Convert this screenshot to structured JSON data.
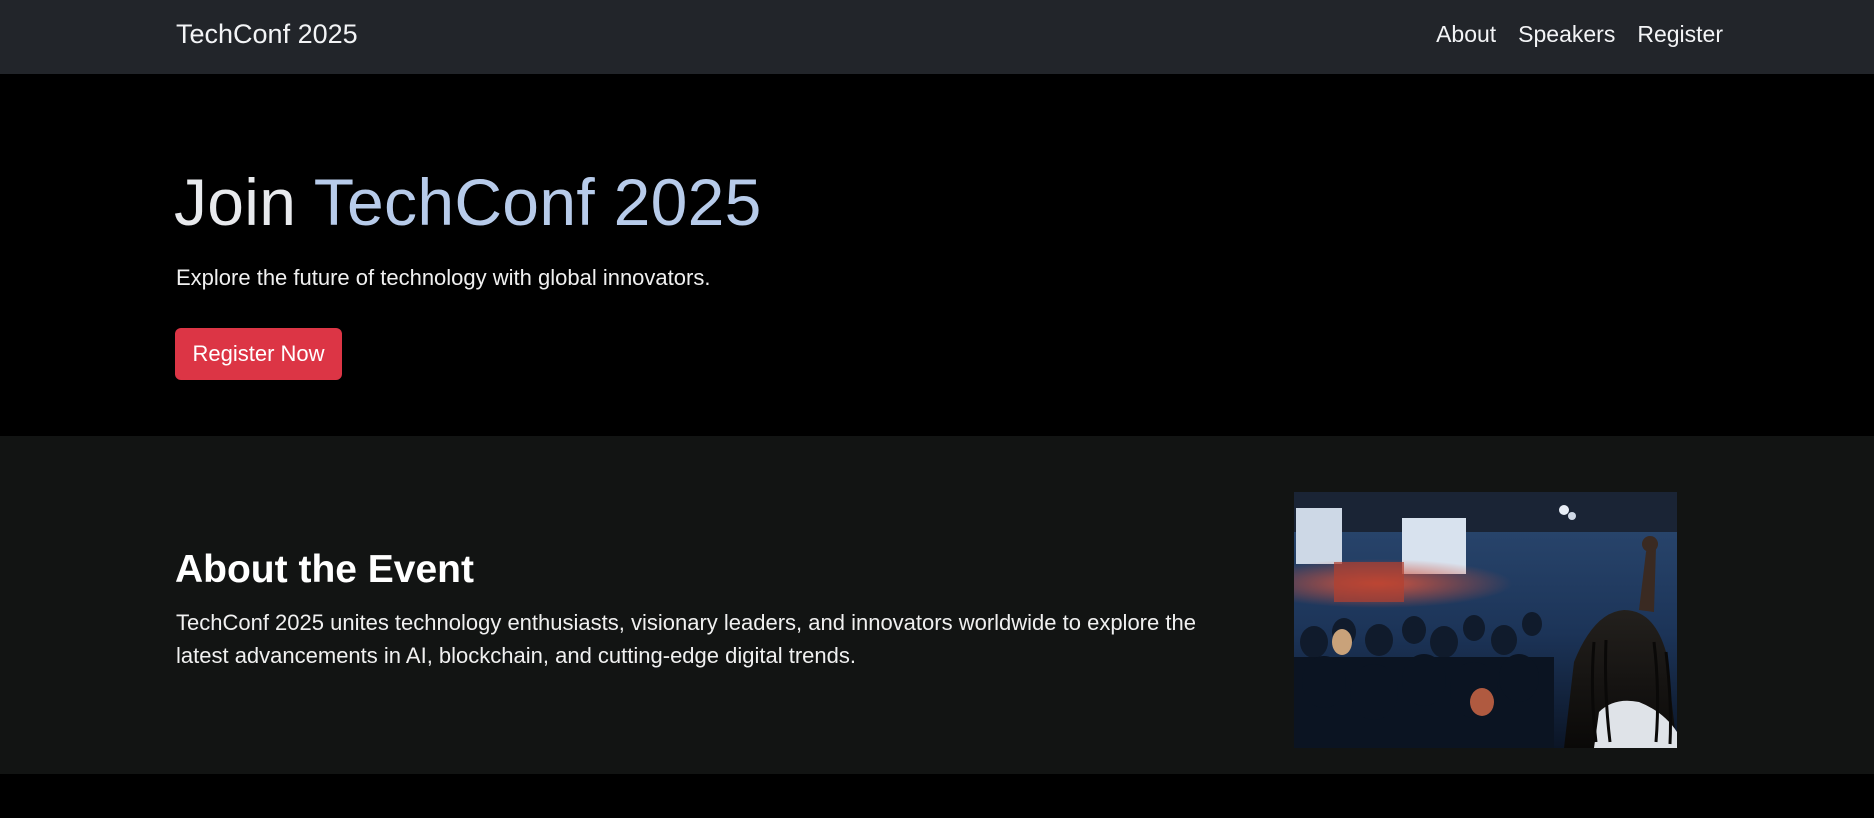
{
  "navbar": {
    "brand": "TechConf 2025",
    "links": [
      {
        "label": "About"
      },
      {
        "label": "Speakers"
      },
      {
        "label": "Register"
      }
    ]
  },
  "hero": {
    "title_lead": "Join",
    "title_accent": "TechConf 2025",
    "subtitle": "Explore the future of technology with global innovators.",
    "cta_label": "Register Now"
  },
  "about": {
    "title": "About the Event",
    "description": "TechConf 2025 unites technology enthusiasts, visionary leaders, and innovators worldwide to explore the latest advancements in AI, blockchain, and cutting-edge digital trends.",
    "image_icon": "conference-audience-photo"
  },
  "colors": {
    "navbar_bg": "#22252a",
    "hero_bg": "#000000",
    "accent_text": "#b7cbea",
    "cta_bg": "#dc3545",
    "about_bg": "#121413"
  }
}
